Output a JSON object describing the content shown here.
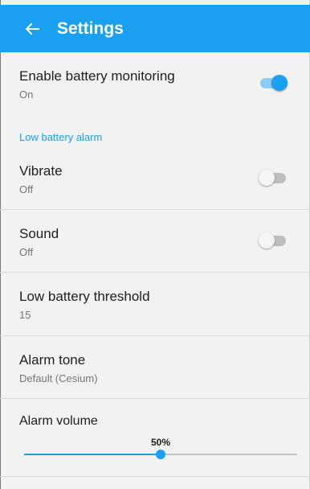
{
  "appbar": {
    "title": "Settings",
    "back_icon": "arrow-left-icon",
    "color": "#1aa0f0"
  },
  "settings": {
    "battery_monitoring": {
      "title": "Enable battery monitoring",
      "summary": "On",
      "enabled": true
    },
    "section_header": "Low battery alarm",
    "vibrate": {
      "title": "Vibrate",
      "summary": "Off",
      "enabled": false
    },
    "sound": {
      "title": "Sound",
      "summary": "Off",
      "enabled": false
    },
    "threshold": {
      "title": "Low battery threshold",
      "summary": "15"
    },
    "alarm_tone": {
      "title": "Alarm tone",
      "summary": "Default (Cesium)"
    },
    "alarm_volume": {
      "title": "Alarm volume",
      "value_label": "50%",
      "value": 0.5
    }
  }
}
